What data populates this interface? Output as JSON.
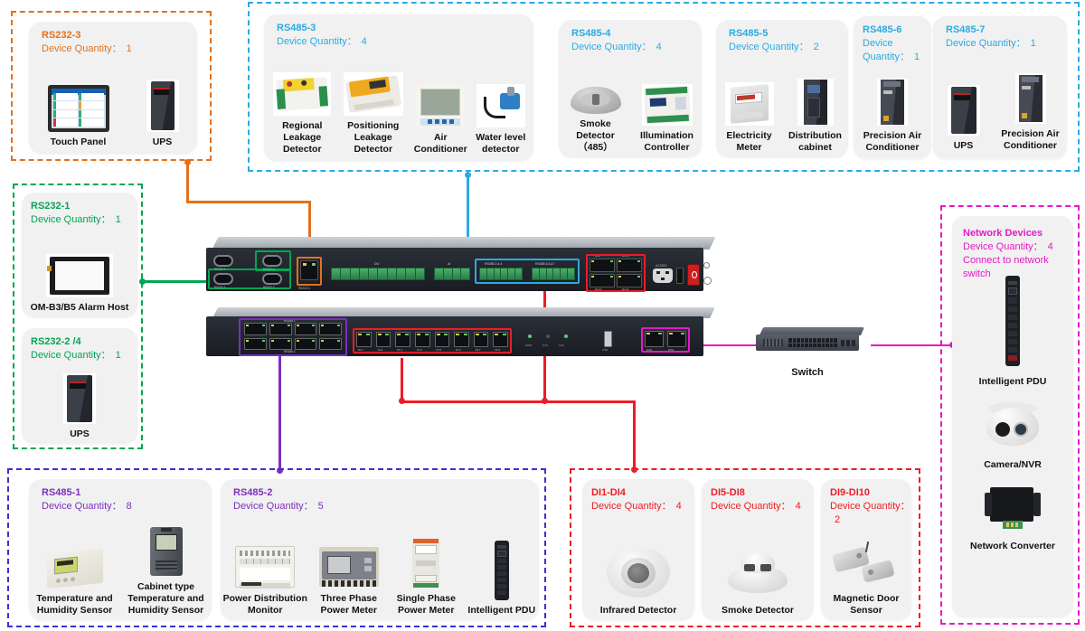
{
  "colors": {
    "orange": "#E2711D",
    "blue": "#29ABE2",
    "green": "#00A651",
    "purple": "#7B2FBE",
    "magenta": "#E917C8",
    "red": "#EE1C25",
    "indigo": "#3A2FD4",
    "card_bg": "#f1f1f1"
  },
  "groups": {
    "rs232_3": {
      "title": "RS232-3",
      "qty_label": "Device Quantity：",
      "qty": "1",
      "devices": [
        {
          "label": "Touch  Panel",
          "icon": "touch-panel-icon"
        },
        {
          "label": "UPS",
          "icon": "ups-icon"
        }
      ]
    },
    "rs485_top": {
      "cards": [
        {
          "title": "RS485-3",
          "qty_label": "Device Quantity：",
          "qty": "4",
          "devices": [
            {
              "label": "Regional Leakage\nDetector",
              "icon": "regional-leakage-detector-icon"
            },
            {
              "label": "Positioning\nLeakage Detector",
              "icon": "positioning-leakage-detector-icon"
            },
            {
              "label": "Air Conditioner",
              "icon": "air-conditioner-icon"
            },
            {
              "label": "Water level\ndetector",
              "icon": "water-level-detector-icon"
            }
          ]
        },
        {
          "title": "RS485-4",
          "qty_label": "Device Quantity：",
          "qty": "4",
          "devices": [
            {
              "label": "Smoke Detector\n（485）",
              "icon": "smoke-detector-485-icon"
            },
            {
              "label": "Illumination\nController",
              "icon": "illumination-controller-icon"
            }
          ]
        },
        {
          "title": "RS485-5",
          "qty_label": "Device Quantity：",
          "qty": "2",
          "devices": [
            {
              "label": "Electricity\nMeter",
              "icon": "electricity-meter-icon"
            },
            {
              "label": "Distribution\ncabinet",
              "icon": "distribution-cabinet-icon"
            }
          ]
        },
        {
          "title": "RS485-6",
          "qty_label": "Device\nQuantity：",
          "qty": "1",
          "devices": [
            {
              "label": "Precision Air\nConditioner",
              "icon": "precision-air-conditioner-icon"
            }
          ]
        },
        {
          "title": "RS485-7",
          "qty_label": "Device Quantity：",
          "qty": "1",
          "devices": [
            {
              "label": "UPS",
              "icon": "ups-icon"
            },
            {
              "label": "Precision Air\nConditioner",
              "icon": "precision-air-conditioner-icon"
            }
          ]
        }
      ]
    },
    "rs232_left": {
      "cards": [
        {
          "title": "RS232-1",
          "qty_label": "Device Quantity：",
          "qty": "1",
          "devices": [
            {
              "label": "OM-B3/B5 Alarm Host",
              "icon": "alarm-host-icon"
            }
          ]
        },
        {
          "title": "RS232-2 /4",
          "qty_label": "Device Quantity：",
          "qty": "1",
          "devices": [
            {
              "label": "UPS",
              "icon": "ups-icon"
            }
          ]
        }
      ]
    },
    "network_devices": {
      "title": "Network Devices",
      "qty_label": "Device Quantity：",
      "qty": "4",
      "note": "Connect to network switch",
      "devices": [
        {
          "label": "Intelligent PDU",
          "icon": "intelligent-pdu-icon"
        },
        {
          "label": "Camera/NVR",
          "icon": "camera-nvr-icon"
        },
        {
          "label": "Network Converter",
          "icon": "network-converter-icon"
        }
      ]
    },
    "rs485_bottom": {
      "cards": [
        {
          "title": "RS485-1",
          "qty_label": "Device Quantity：",
          "qty": "8",
          "devices": [
            {
              "label": "Temperature and\nHumidity Sensor",
              "icon": "temperature-humidity-sensor-icon"
            },
            {
              "label": "Cabinet type\nTemperature and\nHumidity Sensor",
              "icon": "cabinet-temperature-humidity-sensor-icon"
            }
          ]
        },
        {
          "title": "RS485-2",
          "qty_label": "Device Quantity：",
          "qty": "5",
          "devices": [
            {
              "label": "Power Distribution\nMonitor",
              "icon": "power-distribution-monitor-icon"
            },
            {
              "label": "Three Phase\nPower Meter",
              "icon": "three-phase-power-meter-icon"
            },
            {
              "label": "Single Phase\nPower Meter",
              "icon": "single-phase-power-meter-icon"
            },
            {
              "label": "Intelligent PDU",
              "icon": "intelligent-pdu-icon"
            }
          ]
        }
      ]
    },
    "di_bottom": {
      "cards": [
        {
          "title": "DI1-DI4",
          "qty_label": "Device Quantity：",
          "qty": "4",
          "devices": [
            {
              "label": "Infrared Detector",
              "icon": "infrared-detector-icon"
            }
          ]
        },
        {
          "title": "DI5-DI8",
          "qty_label": "Device Quantity：",
          "qty": "4",
          "devices": [
            {
              "label": "Smoke Detector",
              "icon": "smoke-detector-icon"
            }
          ]
        },
        {
          "title": "DI9-DI10",
          "qty_label": "Device Quantity：",
          "qty": "2",
          "devices": [
            {
              "label": "Magnetic Door\nSensor",
              "icon": "magnetic-door-sensor-icon"
            }
          ]
        }
      ]
    }
  },
  "switch": {
    "label": "Switch",
    "icon": "network-switch-icon"
  },
  "hardware": {
    "top_unit": {
      "ports": {
        "rs232_0": "RS232-3",
        "rs232_4": "RS232-4",
        "rs232_1": "RS232-1",
        "rs232_2": "RS232-2",
        "rs232_3_rj45": "RS232-3",
        "do": "DO",
        "ai": "AI",
        "rs485_34": "RS485-3 & 4",
        "rs485_567": "RS485-5,6,&7",
        "di9": "DI-9",
        "di11": "DI-11",
        "di10": "DI-10",
        "di12": "DI-12",
        "ac": "AC220V"
      }
    },
    "bottom_unit": {
      "ports": {
        "rs485_1": "RS485-1",
        "rs485_2": "RS485-2",
        "di": [
          "DI-1",
          "DI-2",
          "DI-3",
          "DI-4",
          "DI-5",
          "DI-6",
          "DI-7",
          "DI-8"
        ],
        "leds": [
          "PWR",
          "SYS",
          "LNK"
        ],
        "usb": "USB",
        "eth2": "Eth2",
        "eth1": "Eth1"
      }
    }
  }
}
